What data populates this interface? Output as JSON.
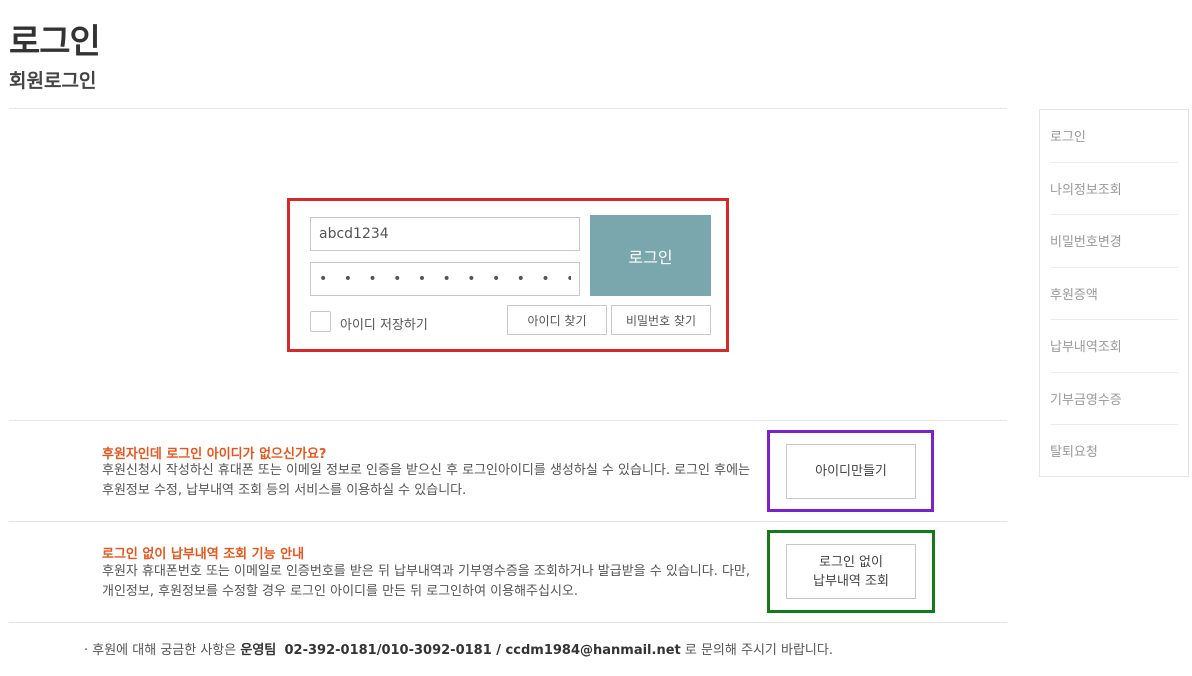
{
  "header": {
    "title": "로그인",
    "subtitle": "회원로그인"
  },
  "login": {
    "id_value": "abcd1234",
    "password_value": "• • • • • • • • • • •",
    "login_label": "로그인",
    "remember_label": "아이디 저장하기",
    "find_id_label": "아이디 찾기",
    "find_pw_label": "비밀번호 찾기"
  },
  "info": [
    {
      "title": "후원자인데 로그인 아이디가 없으신가요?",
      "text": "후원신청시 작성하신 휴대폰 또는 이메일 정보로 인증을 받으신 후 로그인아이디를 생성하실 수 있습니다. 로그인 후에는 후원정보 수정, 납부내역 조회 등의 서비스를 이용하실 수 있습니다.",
      "button": "아이디만들기"
    },
    {
      "title": "로그인 없이 납부내역 조회 기능 안내",
      "text": "후원자 휴대폰번호 또는 이메일로 인증번호를 받은 뒤 납부내역과 기부영수증을 조회하거나 발급받을 수 있습니다. 다만, 개인정보, 후원정보를 수정할 경우 로그인 아이디를 만든 뒤 로그인하여 이용해주십시오.",
      "button": "로그인 없이\n납부내역 조회"
    }
  ],
  "footer": {
    "prefix": "· 후원에 대해 궁금한 사항은 ",
    "team": "운영팀",
    "contact": "02-392-0181/010-3092-0181 / ccdm1984@hanmail.net",
    "suffix": " 로 문의해 주시기 바랍니다."
  },
  "sidebar": {
    "items": [
      {
        "label": "로그인"
      },
      {
        "label": "나의정보조회"
      },
      {
        "label": "비밀번호변경"
      },
      {
        "label": "후원증액"
      },
      {
        "label": "납부내역조회"
      },
      {
        "label": "기부금영수증"
      },
      {
        "label": "탈퇴요청"
      }
    ]
  },
  "colors": {
    "accent_orange": "#e8561e",
    "login_button": "#7aa7ae",
    "highlight_red": "#d42a2a",
    "highlight_purple": "#7b22c9",
    "highlight_green": "#137a18"
  }
}
